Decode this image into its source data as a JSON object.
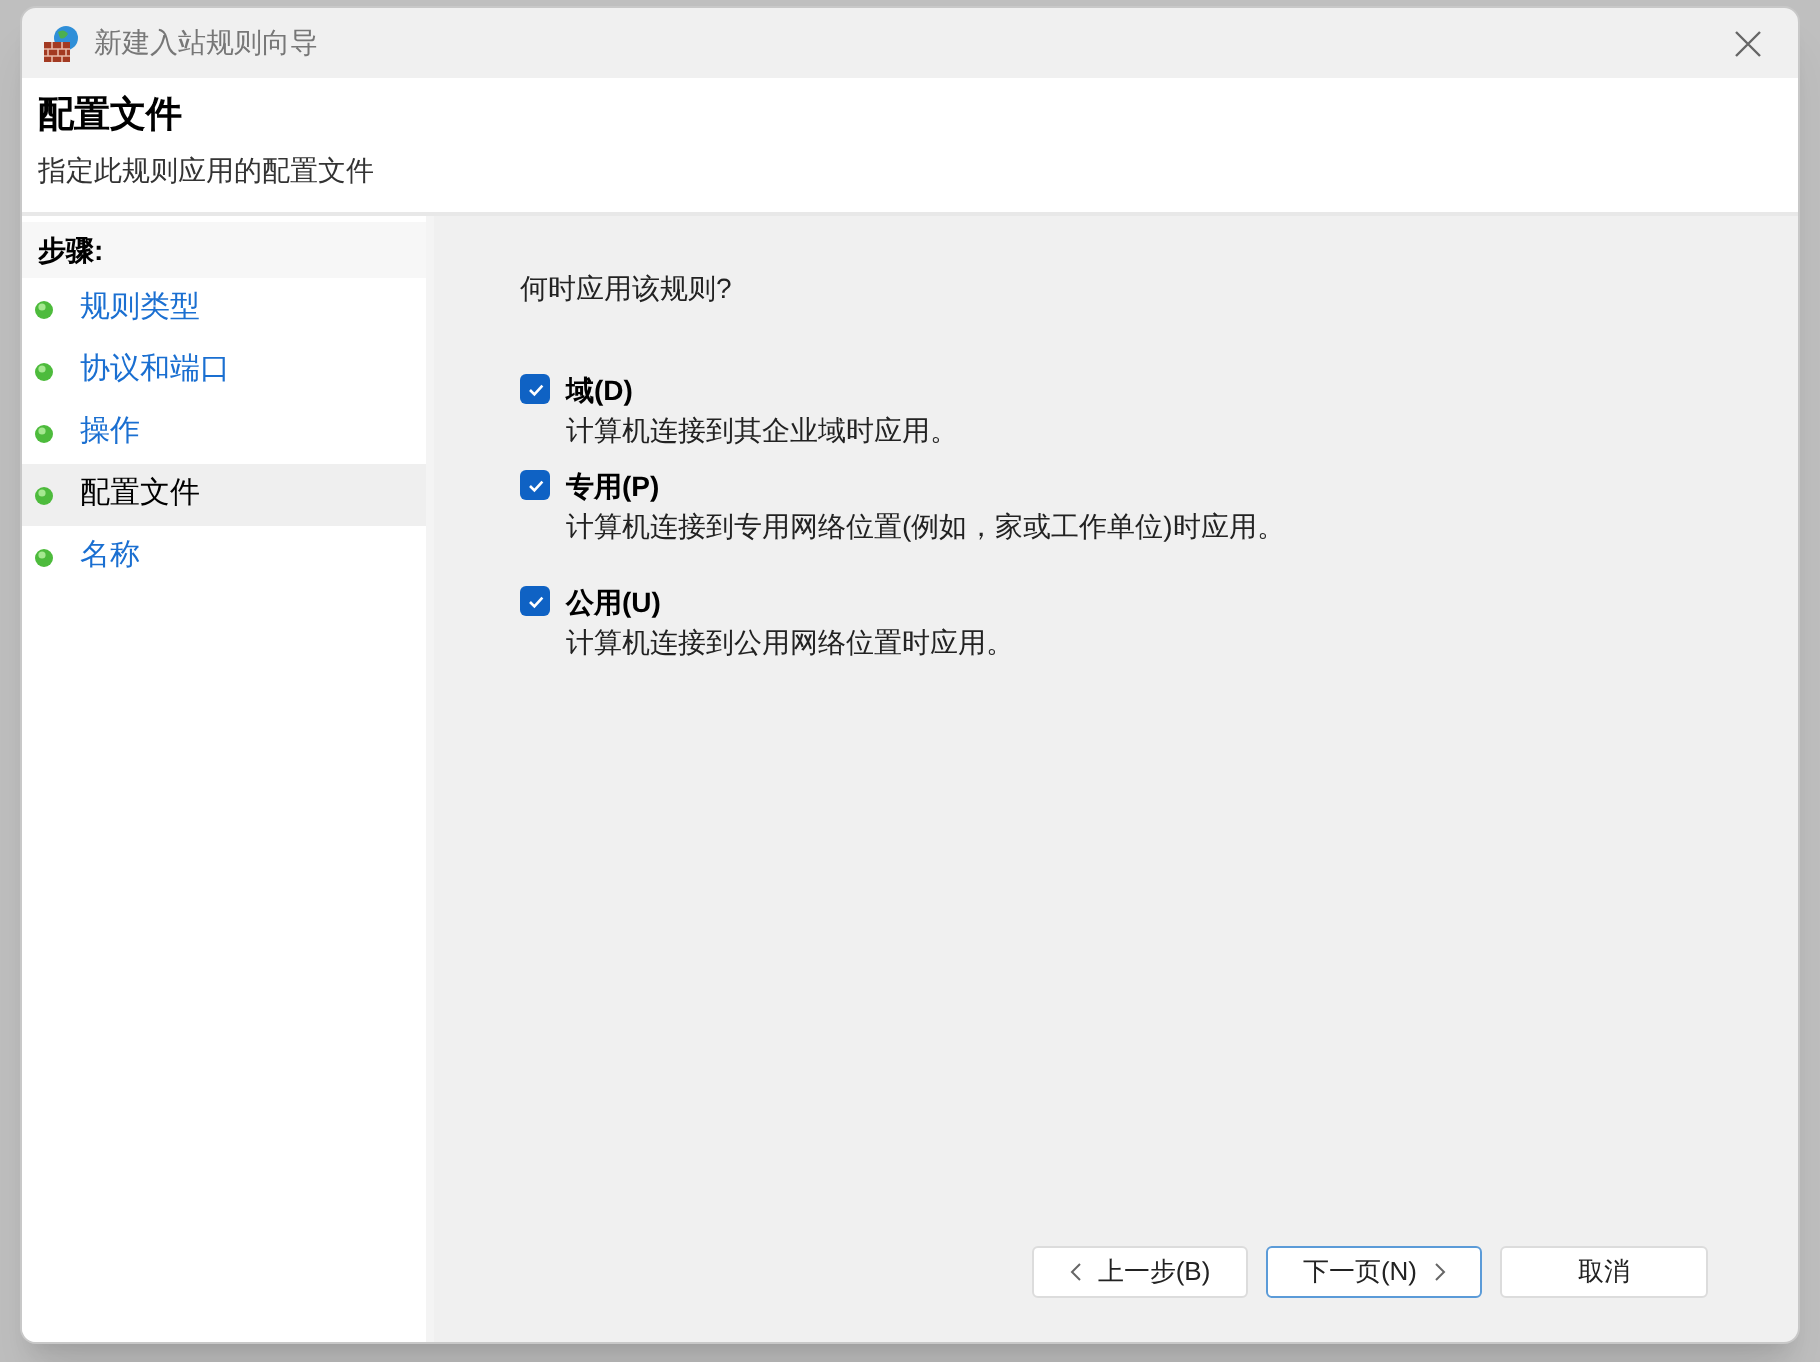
{
  "window": {
    "title": "新建入站规则向导"
  },
  "header": {
    "title": "配置文件",
    "subtitle": "指定此规则应用的配置文件"
  },
  "steps": {
    "heading": "步骤:",
    "items": [
      {
        "label": "规则类型",
        "selected": false
      },
      {
        "label": "协议和端口",
        "selected": false
      },
      {
        "label": "操作",
        "selected": false
      },
      {
        "label": "配置文件",
        "selected": true
      },
      {
        "label": "名称",
        "selected": false
      }
    ]
  },
  "question": "何时应用该规则?",
  "options": [
    {
      "label": "域(D)",
      "description": "计算机连接到其企业域时应用。",
      "checked": true
    },
    {
      "label": "专用(P)",
      "description": "计算机连接到专用网络位置(例如，家或工作单位)时应用。",
      "checked": true
    },
    {
      "label": "公用(U)",
      "description": "计算机连接到公用网络位置时应用。",
      "checked": true
    }
  ],
  "buttons": [
    {
      "label": "上一步(B)",
      "kind": "back",
      "focused": false
    },
    {
      "label": "下一页(N)",
      "kind": "next",
      "focused": true
    },
    {
      "label": "取消",
      "kind": "plain",
      "focused": false
    }
  ]
}
